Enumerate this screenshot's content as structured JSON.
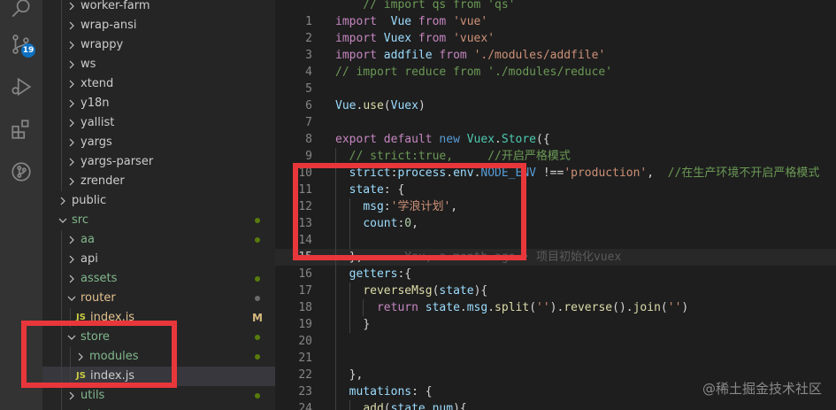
{
  "activity_bar": {
    "scm_badge": "19",
    "icons": [
      "search-icon",
      "source-control-icon",
      "run-debug-icon",
      "extensions-icon",
      "git-graph-icon"
    ]
  },
  "sidebar": {
    "items": [
      {
        "label": "worker-farm",
        "kind": "folder",
        "depth": 2,
        "expanded": false,
        "color": "#cccccc"
      },
      {
        "label": "wrap-ansi",
        "kind": "folder",
        "depth": 2,
        "expanded": false,
        "color": "#cccccc"
      },
      {
        "label": "wrappy",
        "kind": "folder",
        "depth": 2,
        "expanded": false,
        "color": "#cccccc"
      },
      {
        "label": "ws",
        "kind": "folder",
        "depth": 2,
        "expanded": false,
        "color": "#cccccc"
      },
      {
        "label": "xtend",
        "kind": "folder",
        "depth": 2,
        "expanded": false,
        "color": "#cccccc"
      },
      {
        "label": "y18n",
        "kind": "folder",
        "depth": 2,
        "expanded": false,
        "color": "#cccccc"
      },
      {
        "label": "yallist",
        "kind": "folder",
        "depth": 2,
        "expanded": false,
        "color": "#cccccc"
      },
      {
        "label": "yargs",
        "kind": "folder",
        "depth": 2,
        "expanded": false,
        "color": "#cccccc"
      },
      {
        "label": "yargs-parser",
        "kind": "folder",
        "depth": 2,
        "expanded": false,
        "color": "#cccccc"
      },
      {
        "label": "zrender",
        "kind": "folder",
        "depth": 2,
        "expanded": false,
        "color": "#cccccc"
      },
      {
        "label": "public",
        "kind": "folder",
        "depth": 1,
        "expanded": false,
        "color": "#cccccc"
      },
      {
        "label": "src",
        "kind": "folder",
        "depth": 1,
        "expanded": true,
        "color": "#81b88b",
        "dot": "green"
      },
      {
        "label": "aa",
        "kind": "folder",
        "depth": 2,
        "expanded": false,
        "color": "#81b88b",
        "dot": "green"
      },
      {
        "label": "api",
        "kind": "folder",
        "depth": 2,
        "expanded": false,
        "color": "#cccccc"
      },
      {
        "label": "assets",
        "kind": "folder",
        "depth": 2,
        "expanded": false,
        "color": "#81b88b",
        "dot": "green"
      },
      {
        "label": "router",
        "kind": "folder",
        "depth": 2,
        "expanded": true,
        "color": "#e2c08d",
        "dot": "gray"
      },
      {
        "label": "index.js",
        "kind": "file",
        "depth": 3,
        "color": "#e2c08d",
        "status": "M"
      },
      {
        "label": "store",
        "kind": "folder",
        "depth": 2,
        "expanded": true,
        "color": "#81b88b",
        "dot": "green"
      },
      {
        "label": "modules",
        "kind": "folder",
        "depth": 3,
        "expanded": false,
        "color": "#81b88b",
        "dot": "green"
      },
      {
        "label": "index.js",
        "kind": "file",
        "depth": 3,
        "color": "#cccccc",
        "selected": true
      },
      {
        "label": "utils",
        "kind": "folder",
        "depth": 2,
        "expanded": false,
        "color": "#81b88b",
        "dot": "green"
      },
      {
        "label": "views",
        "kind": "folder",
        "depth": 2,
        "expanded": false,
        "color": "#81b88b",
        "dot": "green"
      }
    ],
    "js_label": "JS"
  },
  "editor": {
    "active_line": 15,
    "lines": [
      {
        "n": "",
        "indent": 0,
        "tokens": [
          [
            "c",
            "    // import qs from 'qs'"
          ]
        ]
      },
      {
        "n": "1",
        "indent": 0,
        "tokens": [
          [
            "k",
            "import"
          ],
          [
            "",
            "  "
          ],
          [
            "v",
            "Vue"
          ],
          [
            "",
            ""
          ],
          [
            "k",
            " from"
          ],
          [
            "",
            " "
          ],
          [
            "s",
            "'vue'"
          ]
        ]
      },
      {
        "n": "2",
        "indent": 0,
        "tokens": [
          [
            "k",
            "import"
          ],
          [
            "",
            " "
          ],
          [
            "v",
            "Vuex"
          ],
          [
            "k",
            " from"
          ],
          [
            "",
            " "
          ],
          [
            "s",
            "'vuex'"
          ]
        ]
      },
      {
        "n": "3",
        "indent": 0,
        "tokens": [
          [
            "k",
            "import"
          ],
          [
            "",
            " "
          ],
          [
            "v",
            "addfile"
          ],
          [
            "k",
            " from"
          ],
          [
            "",
            " "
          ],
          [
            "s",
            "'./modules/addfile'"
          ]
        ]
      },
      {
        "n": "4",
        "indent": 0,
        "tokens": [
          [
            "c",
            "// import reduce from './modules/reduce'"
          ]
        ]
      },
      {
        "n": "5",
        "indent": 0,
        "tokens": []
      },
      {
        "n": "6",
        "indent": 0,
        "tokens": [
          [
            "v",
            "Vue"
          ],
          [
            "",
            "."
          ],
          [
            "f",
            "use"
          ],
          [
            "",
            "("
          ],
          [
            "v",
            "Vuex"
          ],
          [
            "",
            ")"
          ]
        ]
      },
      {
        "n": "7",
        "indent": 0,
        "tokens": []
      },
      {
        "n": "8",
        "indent": 0,
        "tokens": [
          [
            "k",
            "export"
          ],
          [
            "",
            " "
          ],
          [
            "k",
            "default"
          ],
          [
            "",
            " "
          ],
          [
            "b",
            "new"
          ],
          [
            "",
            " "
          ],
          [
            "t",
            "Vuex"
          ],
          [
            "",
            "."
          ],
          [
            "t",
            "Store"
          ],
          [
            "",
            "({"
          ]
        ]
      },
      {
        "n": "9",
        "indent": 1,
        "tokens": [
          [
            "c",
            "// strict:true,     //开启严格模式"
          ]
        ]
      },
      {
        "n": "10",
        "indent": 1,
        "tokens": [
          [
            "v",
            "strict"
          ],
          [
            "",
            ":"
          ],
          [
            "v",
            "process"
          ],
          [
            "",
            "."
          ],
          [
            "v",
            "env"
          ],
          [
            "",
            "."
          ],
          [
            "b",
            "NODE_ENV"
          ],
          [
            "",
            " !=="
          ],
          [
            "s",
            "'production'"
          ],
          [
            "",
            ",  "
          ],
          [
            "c",
            "//在生产环境不开启严格模式"
          ]
        ]
      },
      {
        "n": "11",
        "indent": 1,
        "tokens": [
          [
            "v",
            "state"
          ],
          [
            "",
            ": {"
          ]
        ]
      },
      {
        "n": "12",
        "indent": 2,
        "tokens": [
          [
            "v",
            "msg"
          ],
          [
            "",
            ":"
          ],
          [
            "s",
            "'学浪计划'"
          ],
          [
            "",
            ","
          ]
        ]
      },
      {
        "n": "13",
        "indent": 2,
        "tokens": [
          [
            "v",
            "count"
          ],
          [
            "",
            ":"
          ],
          [
            "n",
            "0"
          ],
          [
            "",
            ","
          ]
        ]
      },
      {
        "n": "14",
        "indent": 2,
        "tokens": []
      },
      {
        "n": "15",
        "indent": 1,
        "tokens": [
          [
            "",
            "},"
          ],
          [
            "blame",
            "      You, a month ago • 项目初始化vuex"
          ]
        ]
      },
      {
        "n": "16",
        "indent": 1,
        "tokens": [
          [
            "v",
            "getters"
          ],
          [
            "",
            ":{"
          ]
        ]
      },
      {
        "n": "17",
        "indent": 2,
        "tokens": [
          [
            "f",
            "reverseMsg"
          ],
          [
            "",
            "("
          ],
          [
            "v",
            "state"
          ],
          [
            "",
            "){"
          ]
        ]
      },
      {
        "n": "18",
        "indent": 3,
        "tokens": [
          [
            "k",
            "return"
          ],
          [
            "",
            " "
          ],
          [
            "v",
            "state"
          ],
          [
            "",
            "."
          ],
          [
            "v",
            "msg"
          ],
          [
            "",
            "."
          ],
          [
            "f",
            "split"
          ],
          [
            "",
            "("
          ],
          [
            "s",
            "''"
          ],
          [
            "",
            ")."
          ],
          [
            "f",
            "reverse"
          ],
          [
            "",
            "()."
          ],
          [
            "f",
            "join"
          ],
          [
            "",
            "("
          ],
          [
            "s",
            "''"
          ],
          [
            "",
            ")"
          ]
        ]
      },
      {
        "n": "19",
        "indent": 2,
        "tokens": [
          [
            "",
            "}"
          ]
        ]
      },
      {
        "n": "20",
        "indent": 1,
        "tokens": []
      },
      {
        "n": "21",
        "indent": 1,
        "tokens": []
      },
      {
        "n": "22",
        "indent": 1,
        "tokens": [
          [
            "",
            "},"
          ]
        ]
      },
      {
        "n": "23",
        "indent": 1,
        "tokens": [
          [
            "v",
            "mutations"
          ],
          [
            "",
            ": {"
          ]
        ]
      },
      {
        "n": "24",
        "indent": 2,
        "tokens": [
          [
            "f",
            "add"
          ],
          [
            "",
            "("
          ],
          [
            "v",
            "state"
          ],
          [
            "",
            ","
          ],
          [
            "v",
            "num"
          ],
          [
            "",
            "){"
          ]
        ]
      }
    ]
  },
  "watermark": "@稀土掘金技术社区",
  "colors": {
    "highlight_box": "#e8373b",
    "accent": "#0e70c0"
  }
}
